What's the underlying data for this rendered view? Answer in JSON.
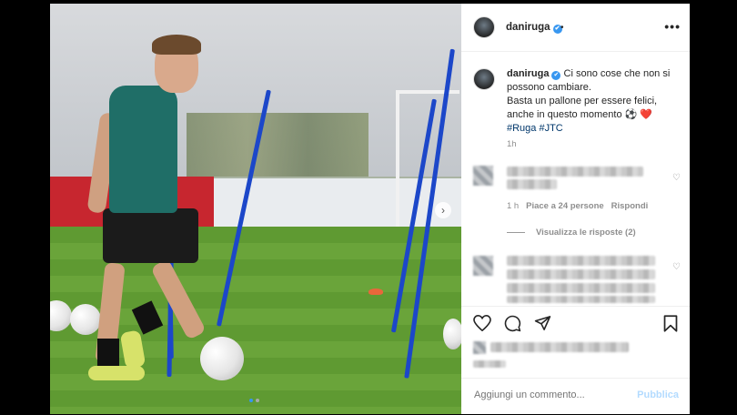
{
  "header": {
    "username": "daniruga",
    "verified_mark": "✔",
    "separator": "•",
    "more": "•••"
  },
  "caption": {
    "username": "daniruga",
    "line1": "Ci sono cose che non si",
    "line2": "possono cambiare.",
    "line3": "Basta un pallone per essere felici,",
    "line4": "anche in questo momento ⚽ ❤️",
    "hashtags": "#Ruga #JTC",
    "time": "1h"
  },
  "comment1": {
    "time": "1 h",
    "likes": "Piace a 24 persone",
    "reply": "Rispondi",
    "view_replies": "Visualizza le risposte (2)"
  },
  "add_comment": {
    "placeholder": "Aggiungi un commento...",
    "publish": "Pubblica"
  },
  "photo": {
    "carousel_next": "›",
    "slide_count": 2,
    "active_slide": 1
  },
  "colors": {
    "verified": "#3897f0",
    "hashtag": "#00376b",
    "muted": "#8e8e8e",
    "publish_disabled": "#b3dbff",
    "pole_blue": "#1c47c9",
    "heart_red": "#ed4956"
  },
  "icons": [
    "heart-icon",
    "comment-icon",
    "share-icon",
    "bookmark-icon",
    "more-icon",
    "verified-icon",
    "next-icon"
  ]
}
